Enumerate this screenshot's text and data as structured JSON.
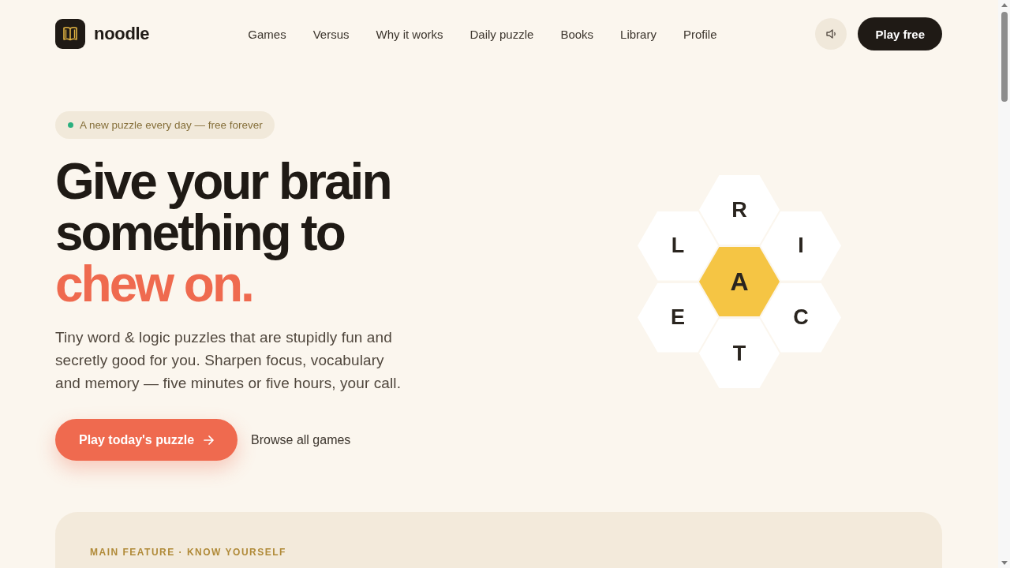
{
  "header": {
    "brand": "noodle",
    "nav": [
      {
        "label": "Games"
      },
      {
        "label": "Versus"
      },
      {
        "label": "Why it works"
      },
      {
        "label": "Daily puzzle"
      },
      {
        "label": "Books"
      },
      {
        "label": "Library"
      },
      {
        "label": "Profile"
      }
    ],
    "cta": "Play free"
  },
  "hero": {
    "badge": "A new puzzle every day — free forever",
    "headline": {
      "lines": [
        "Give your brain",
        "something to"
      ],
      "accent": "chew on."
    },
    "description": "Tiny word & logic puzzles that are stupidly fun and secretly good for you. Sharpen focus, vocabulary and memory — five minutes or five hours, your call.",
    "primary_button": "Play today's puzzle",
    "secondary_link": "Browse all games"
  },
  "puzzle": {
    "tiles": [
      {
        "letter": "R",
        "kind": "outer"
      },
      {
        "letter": "L",
        "kind": "outer"
      },
      {
        "letter": "I",
        "kind": "outer"
      },
      {
        "letter": "A",
        "kind": "center"
      },
      {
        "letter": "E",
        "kind": "outer"
      },
      {
        "letter": "C",
        "kind": "outer"
      },
      {
        "letter": "T",
        "kind": "outer"
      }
    ]
  },
  "feature": {
    "eyebrow": "MAIN FEATURE · KNOW YOURSELF"
  }
}
